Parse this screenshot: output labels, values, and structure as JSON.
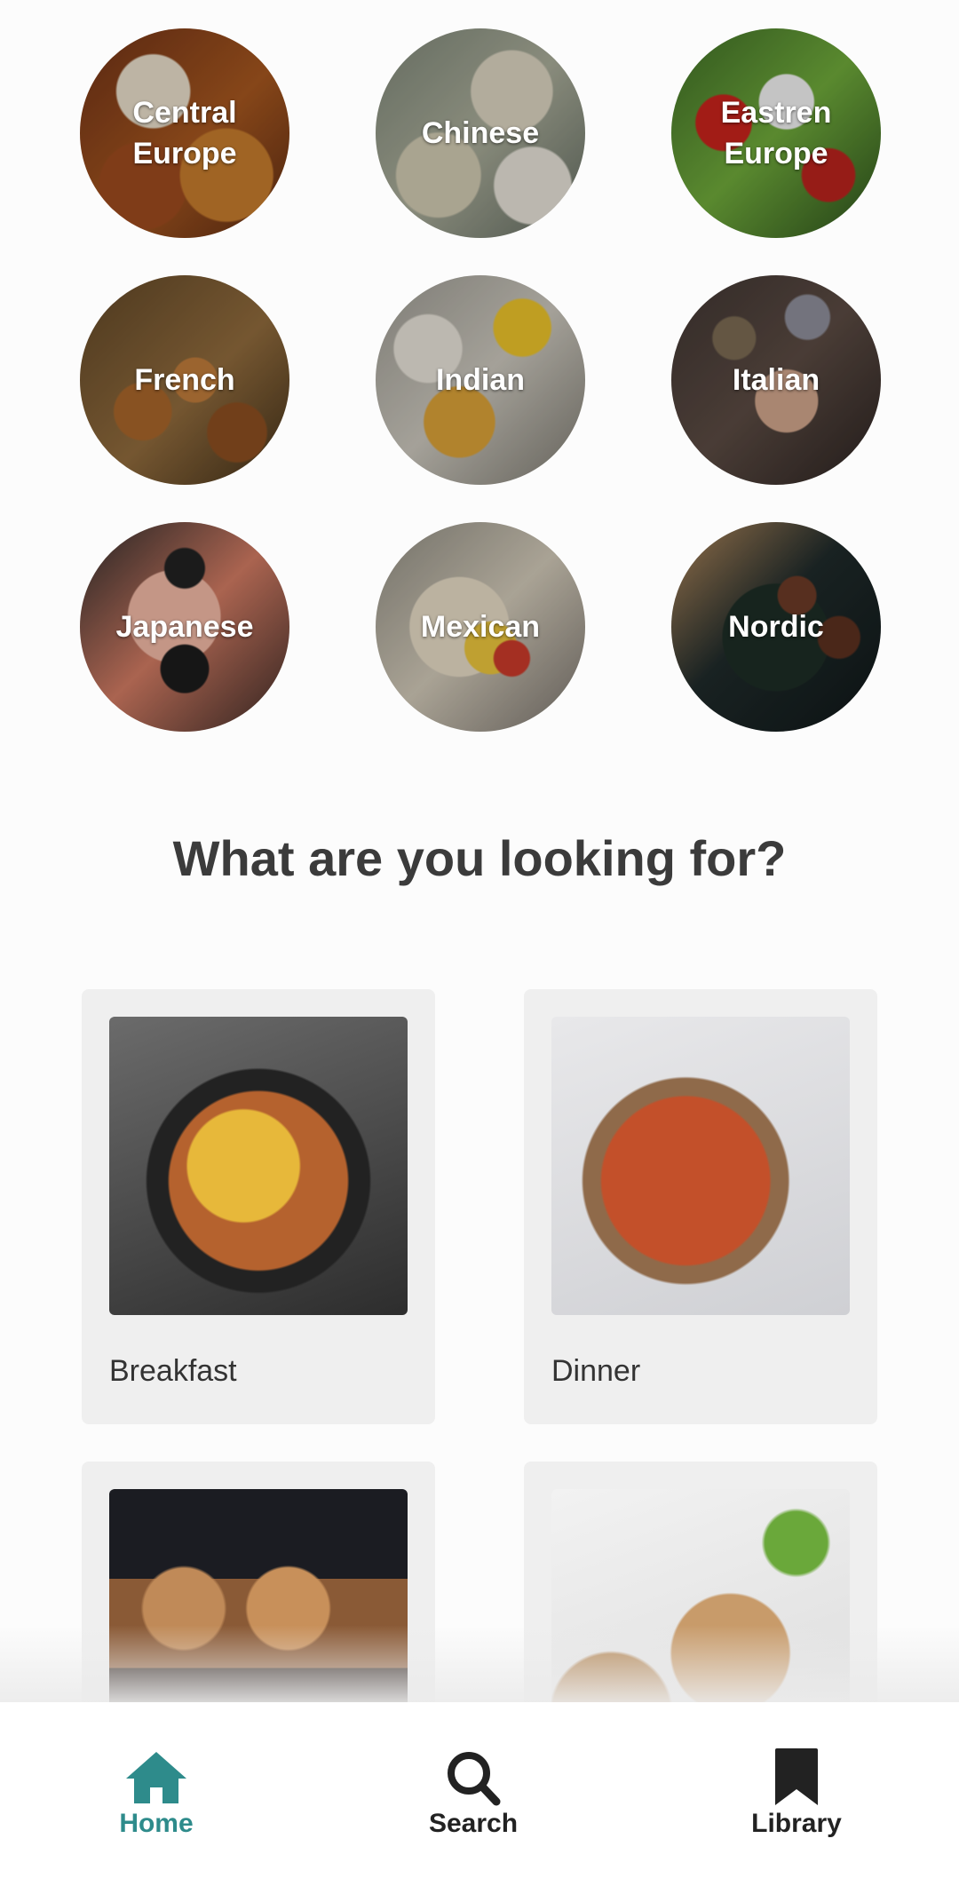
{
  "cuisines": [
    {
      "label": "Central Europe"
    },
    {
      "label": "Chinese"
    },
    {
      "label": "Eastren Europe"
    },
    {
      "label": "French"
    },
    {
      "label": "Indian"
    },
    {
      "label": "Italian"
    },
    {
      "label": "Japanese"
    },
    {
      "label": "Mexican"
    },
    {
      "label": "Nordic"
    }
  ],
  "section_title": "What are you looking for?",
  "categories": [
    {
      "label": "Breakfast"
    },
    {
      "label": "Dinner"
    },
    {
      "label": ""
    },
    {
      "label": ""
    }
  ],
  "nav": {
    "home": {
      "label": "Home",
      "icon": "home-icon",
      "active": true
    },
    "search": {
      "label": "Search",
      "icon": "search-icon"
    },
    "library": {
      "label": "Library",
      "icon": "bookmark-icon"
    }
  },
  "colors": {
    "accent": "#2e8b8b",
    "background": "#fcfcfc",
    "card": "#efefef",
    "title": "#3b3b3b"
  }
}
